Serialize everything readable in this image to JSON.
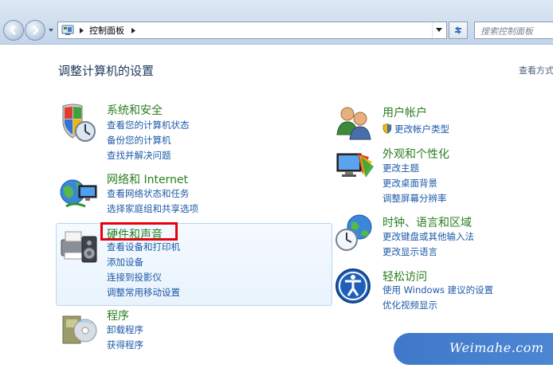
{
  "address_bar": {
    "path": "控制面板",
    "search_placeholder": "搜索控制面板"
  },
  "header": {
    "title": "调整计算机的设置",
    "view_by": "查看方式"
  },
  "categories": [
    {
      "title": "系统和安全",
      "links": [
        "查看您的计算机状态",
        "备份您的计算机",
        "查找并解决问题"
      ]
    },
    {
      "title": "网络和 Internet",
      "links": [
        "查看网络状态和任务",
        "选择家庭组和共享选项"
      ]
    },
    {
      "title": "硬件和声音",
      "links": [
        "查看设备和打印机",
        "添加设备",
        "连接到投影仪",
        "调整常用移动设置"
      ]
    },
    {
      "title": "程序",
      "links": [
        "卸载程序",
        "获得程序"
      ]
    },
    {
      "title": "用户帐户",
      "links": [
        "更改帐户类型"
      ]
    },
    {
      "title": "外观和个性化",
      "links": [
        "更改主题",
        "更改桌面背景",
        "调整屏幕分辨率"
      ]
    },
    {
      "title": "时钟、语言和区域",
      "links": [
        "更改键盘或其他输入法",
        "更改显示语言"
      ]
    },
    {
      "title": "轻松访问",
      "links": [
        "使用 Windows 建议的设置",
        "优化视频显示"
      ]
    }
  ],
  "watermark": "Weimahe.com",
  "colors": {
    "category_title": "#2a7e1f",
    "link": "#1e5aa8",
    "highlight_border": "#e8000d"
  }
}
